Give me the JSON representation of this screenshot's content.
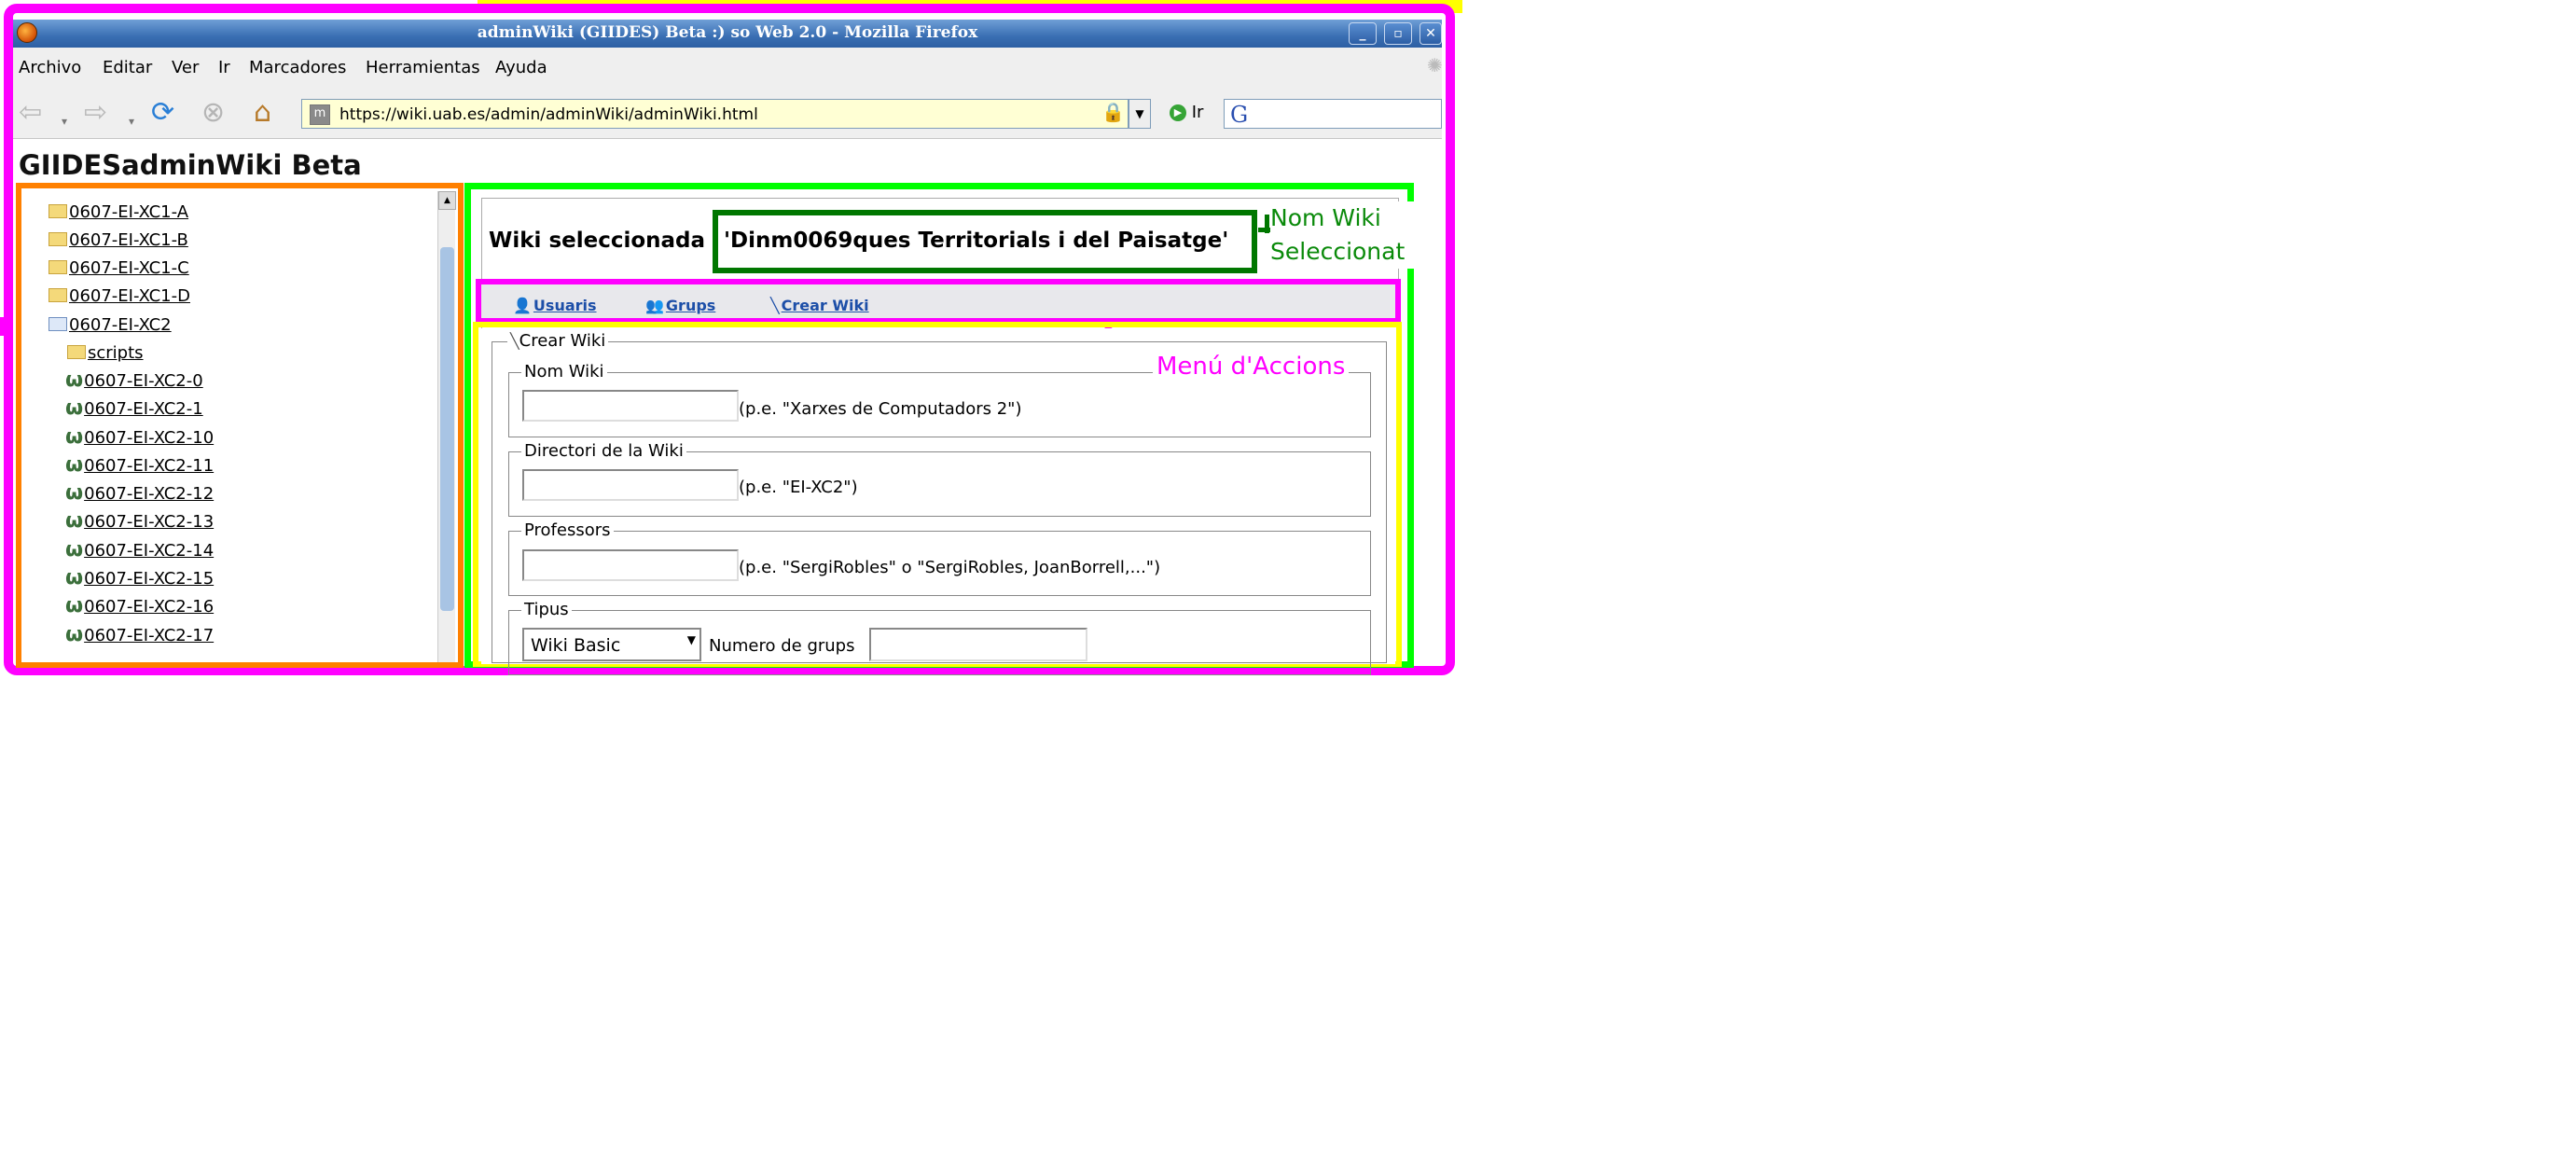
{
  "window": {
    "title": "adminWiki (GIIDES) Beta :) so Web 2.0 - Mozilla Firefox",
    "controls": [
      "_",
      "▫",
      "✕"
    ]
  },
  "menubar": [
    "Archivo",
    "Editar",
    "Ver",
    "Ir",
    "Marcadores",
    "Herramientas",
    "Ayuda"
  ],
  "toolbar": {
    "url": "https://wiki.uab.es/admin/adminWiki/adminWiki.html",
    "go_label": "Ir",
    "favicon_letter": "m"
  },
  "page": {
    "title": "GIIDESadminWiki Beta"
  },
  "tree": [
    {
      "label": "0607-EI-XC1-A",
      "kind": "folder"
    },
    {
      "label": "0607-EI-XC1-B",
      "kind": "folder"
    },
    {
      "label": "0607-EI-XC1-C",
      "kind": "folder"
    },
    {
      "label": "0607-EI-XC1-D",
      "kind": "folder"
    },
    {
      "label": "0607-EI-XC2",
      "kind": "open-folder"
    },
    {
      "label": "scripts",
      "kind": "folder"
    },
    {
      "label": "0607-EI-XC2-0",
      "kind": "wiki"
    },
    {
      "label": "0607-EI-XC2-1",
      "kind": "wiki"
    },
    {
      "label": "0607-EI-XC2-10",
      "kind": "wiki"
    },
    {
      "label": "0607-EI-XC2-11",
      "kind": "wiki"
    },
    {
      "label": "0607-EI-XC2-12",
      "kind": "wiki"
    },
    {
      "label": "0607-EI-XC2-13",
      "kind": "wiki"
    },
    {
      "label": "0607-EI-XC2-14",
      "kind": "wiki"
    },
    {
      "label": "0607-EI-XC2-15",
      "kind": "wiki"
    },
    {
      "label": "0607-EI-XC2-16",
      "kind": "wiki"
    },
    {
      "label": "0607-EI-XC2-17",
      "kind": "wiki"
    }
  ],
  "selection": {
    "label": "Wiki seleccionada",
    "value": "'Dinm0069ques Territorials i del Paisatge'"
  },
  "actions_menu": [
    {
      "label": "Usuaris",
      "icon": "user-icon"
    },
    {
      "label": "Grups",
      "icon": "group-icon"
    },
    {
      "label": "Crear Wiki",
      "icon": "wand-icon"
    }
  ],
  "annotations": {
    "nom_wiki": [
      "Nom Wiki",
      "Seleccionat"
    ],
    "menu_accions": "Menú d'Accions"
  },
  "form": {
    "legend": "Crear Wiki",
    "nom": {
      "legend": "Nom Wiki",
      "hint": "(p.e. \"Xarxes de Computadors 2\")",
      "value": ""
    },
    "directori": {
      "legend": "Directori de la Wiki",
      "hint": "(p.e. \"EI-XC2\")",
      "value": ""
    },
    "professors": {
      "legend": "Professors",
      "hint": "(p.e. \"SergiRobles\" o \"SergiRobles, JoanBorrell,...\")",
      "value": ""
    },
    "tipus": {
      "legend": "Tipus",
      "selected": "Wiki Basic",
      "groups_label": "Numero de grups",
      "groups_value": ""
    }
  },
  "colors": {
    "frame_magenta": "#ff00ff",
    "frame_green": "#00ff00",
    "frame_yellow": "#ffff00",
    "frame_orange": "#ff8000",
    "selection_green": "#007700"
  }
}
